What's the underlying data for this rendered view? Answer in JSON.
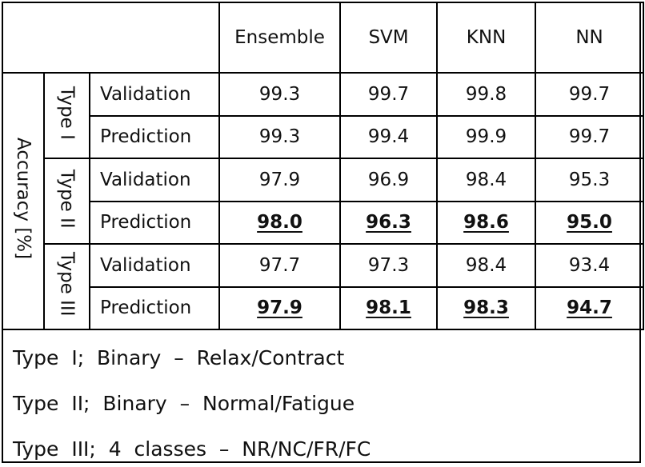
{
  "table": {
    "columns": [
      "Ensemble",
      "SVM",
      "KNN",
      "NN"
    ],
    "row_group_label": "Accuracy [%]",
    "groups": [
      {
        "type_label": "Type I",
        "rows": [
          {
            "label": "Validation",
            "values": [
              "99.3",
              "99.7",
              "99.8",
              "99.7"
            ],
            "emphasized": false
          },
          {
            "label": "Prediction",
            "values": [
              "99.3",
              "99.4",
              "99.9",
              "99.7"
            ],
            "emphasized": false
          }
        ]
      },
      {
        "type_label": "Type II",
        "rows": [
          {
            "label": "Validation",
            "values": [
              "97.9",
              "96.9",
              "98.4",
              "95.3"
            ],
            "emphasized": false
          },
          {
            "label": "Prediction",
            "values": [
              "98.0",
              "96.3",
              "98.6",
              "95.0"
            ],
            "emphasized": true
          }
        ]
      },
      {
        "type_label": "Type III",
        "rows": [
          {
            "label": "Validation",
            "values": [
              "97.7",
              "97.3",
              "98.4",
              "93.4"
            ],
            "emphasized": false
          },
          {
            "label": "Prediction",
            "values": [
              "97.9",
              "98.1",
              "98.3",
              "94.7"
            ],
            "emphasized": true
          }
        ]
      }
    ]
  },
  "footnotes": [
    "Type  I;  Binary  –  Relax/Contract",
    "Type  II;  Binary  –  Normal/Fatigue",
    "Type  III;  4  classes  –  NR/NC/FR/FC"
  ]
}
